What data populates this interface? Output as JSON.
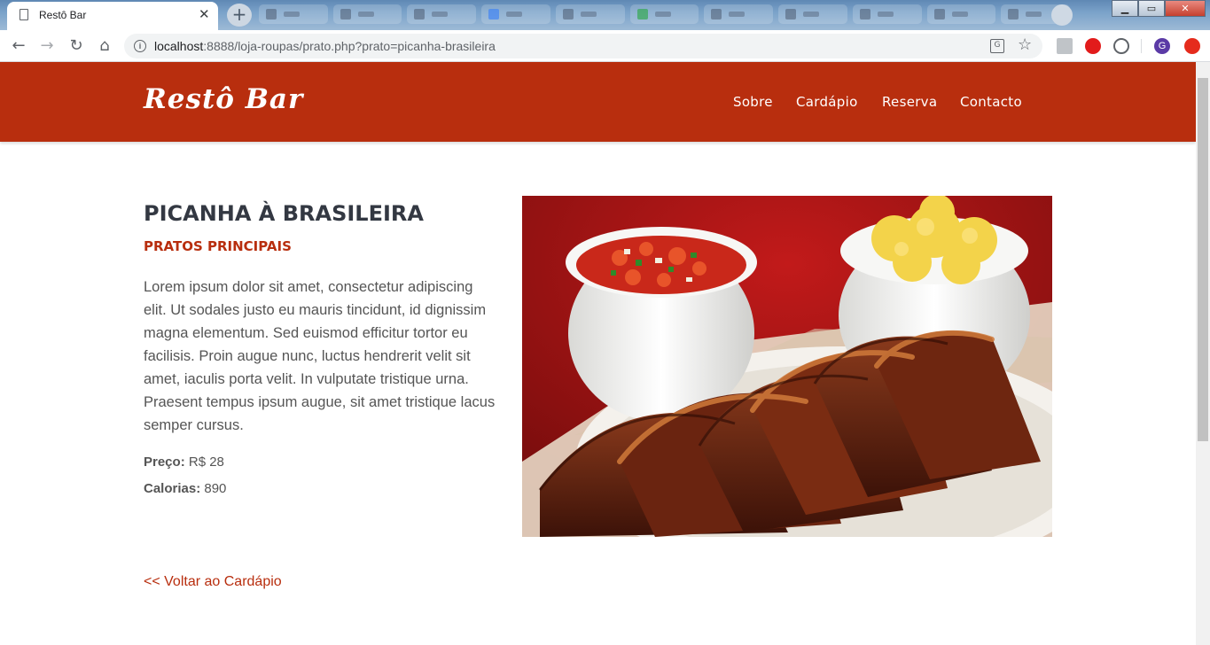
{
  "browser": {
    "tab_title": "Restô Bar",
    "tab_close": "✕",
    "new_tab": "+",
    "url_host": "localhost",
    "url_path": ":8888/loja-roupas/prato.php?prato=picanha-brasileira",
    "profile_initial": "G",
    "window_buttons": {
      "minimize": "▁",
      "maximize": "▭",
      "close": "✕"
    },
    "nav_icons": {
      "back": "back-arrow-icon",
      "forward": "forward-arrow-icon",
      "reload": "reload-icon",
      "home": "home-icon"
    }
  },
  "site": {
    "logo": "Restô Bar",
    "nav": [
      "Sobre",
      "Cardápio",
      "Reserva",
      "Contacto"
    ],
    "colors": {
      "brand": "#b82e0e",
      "text_dark": "#333842",
      "text": "#555555"
    }
  },
  "dish": {
    "name": "PICANHA À BRASILEIRA",
    "category": "PRATOS PRINCIPAIS",
    "description": "Lorem ipsum dolor sit amet, consectetur adipiscing elit. Ut sodales justo eu mauris tincidunt, id dignissim magna elementum. Sed euismod efficitur tortor eu facilisis. Proin augue nunc, luctus hendrerit velit sit amet, iaculis porta velit. In vulputate tristique urna. Praesent tempus ipsum augue, sit amet tristique lacus semper cursus.",
    "price_label": "Preço:",
    "price_value": "R$ 28",
    "calories_label": "Calorias:",
    "calories_value": "890"
  },
  "back_link": "<< Voltar ao Cardápio"
}
